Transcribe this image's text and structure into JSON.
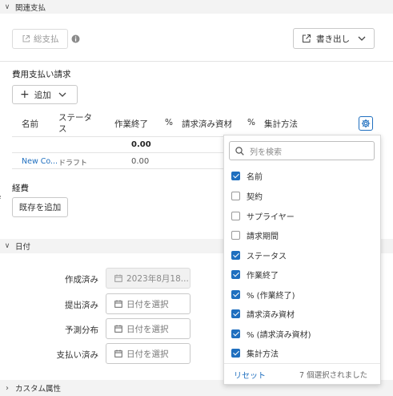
{
  "sections": {
    "related": "関連支払",
    "dates": "日付",
    "custom": "カスタム属性"
  },
  "toolbar": {
    "total_label": "総支払",
    "export_label": "書き出し"
  },
  "expense_requests": {
    "title": "費用支払い請求",
    "add_label": "追加",
    "columns": [
      "名前",
      "ステータス",
      "作業終了",
      "%",
      "請求済み資材",
      "%",
      "集計方法"
    ],
    "total_row": {
      "work_done": "0.00"
    },
    "rows": [
      {
        "name": "New Co...",
        "status": "ドラフト",
        "work_done": "0.00"
      }
    ]
  },
  "expenses": {
    "title": "経費",
    "add_existing_label": "既存を追加"
  },
  "dates": {
    "created_label": "作成済み",
    "created_value": "2023年8月18...",
    "submitted_label": "提出済み",
    "forecast_label": "予測分布",
    "paid_label": "支払い済み",
    "placeholder": "日付を選択"
  },
  "column_picker": {
    "search_placeholder": "列を検索",
    "items": [
      {
        "label": "名前",
        "checked": true
      },
      {
        "label": "契約",
        "checked": false
      },
      {
        "label": "サプライヤー",
        "checked": false
      },
      {
        "label": "請求期間",
        "checked": false
      },
      {
        "label": "ステータス",
        "checked": true
      },
      {
        "label": "作業終了",
        "checked": true
      },
      {
        "label": "% (作業終了)",
        "checked": true
      },
      {
        "label": "請求済み資材",
        "checked": true
      },
      {
        "label": "% (請求済み資材)",
        "checked": true
      },
      {
        "label": "集計方法",
        "checked": true
      }
    ],
    "reset_label": "リセット",
    "selected_count": "7 個選択されました"
  },
  "colors": {
    "accent": "#1f6fbf",
    "link": "#1f6fbf",
    "section_bg": "#f3f3f3"
  }
}
